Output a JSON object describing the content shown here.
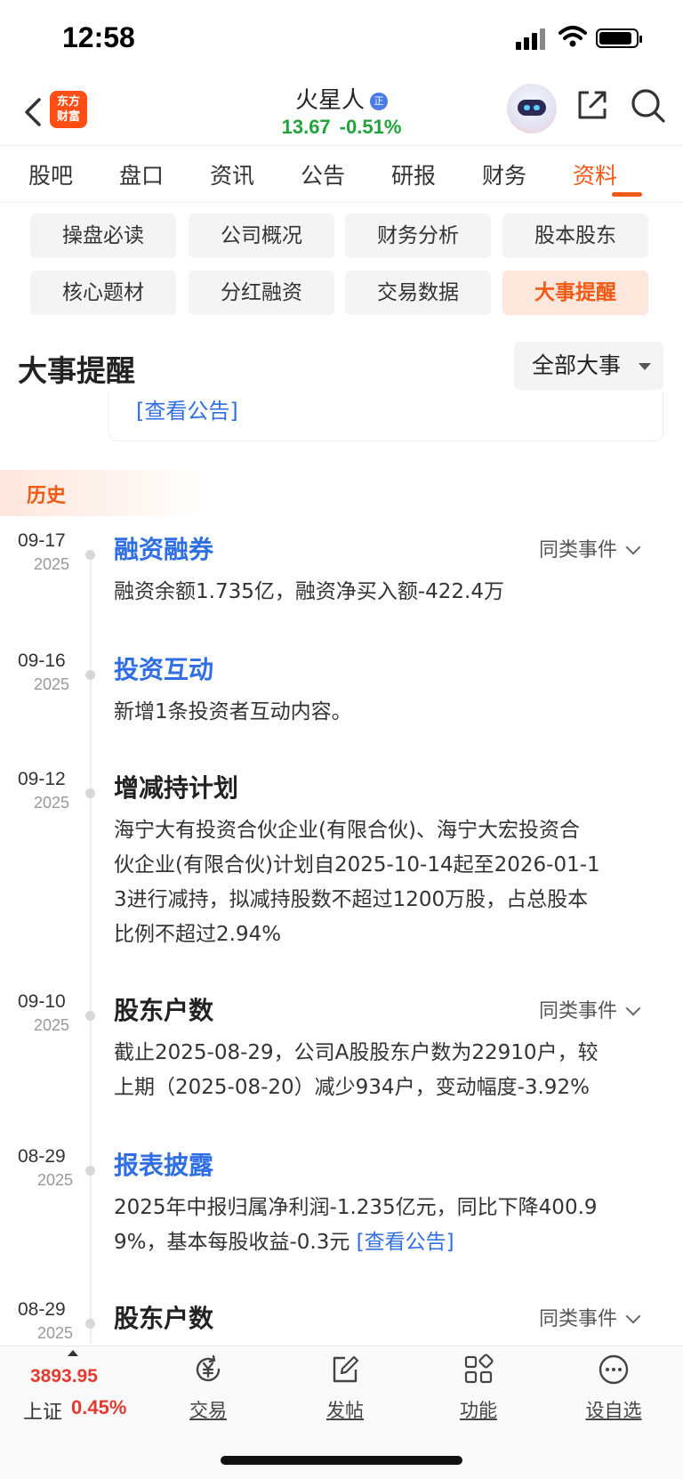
{
  "status_bar": {
    "time": "12:58"
  },
  "header": {
    "app_logo": "东方财富",
    "stock_name": "火星人",
    "reg_badge": "正",
    "price": "13.67",
    "change_pct": "-0.51%",
    "icons": [
      "back-icon",
      "robot-assistant-icon",
      "share-icon",
      "search-icon"
    ]
  },
  "tabs": [
    "股吧",
    "盘口",
    "资讯",
    "公告",
    "研报",
    "财务",
    "资料"
  ],
  "active_tab": "资料",
  "sub_tabs": [
    "操盘必读",
    "公司概况",
    "财务分析",
    "股本股东",
    "核心题材",
    "分红融资",
    "交易数据",
    "大事提醒"
  ],
  "active_sub_tab": "大事提醒",
  "section": {
    "title": "大事提醒",
    "filter": "全部大事",
    "prev_link": "[查看公告]",
    "history_label": "历史"
  },
  "similar_label": "同类事件",
  "events": [
    {
      "date": "09-17",
      "year": "2025",
      "title": "融资融券",
      "style": "blue",
      "similar": true,
      "lines": [
        "融资余额1.735亿，融资净买入额-422.4万"
      ]
    },
    {
      "date": "09-16",
      "year": "2025",
      "title": "投资互动",
      "style": "blue",
      "similar": false,
      "lines": [
        "新增1条投资者互动内容。"
      ]
    },
    {
      "date": "09-12",
      "year": "2025",
      "title": "增减持计划",
      "style": "dark",
      "similar": false,
      "lines": [
        "海宁大有投资合伙企业(有限合伙)、海宁大宏投资合",
        "伙企业(有限合伙)计划自2025-10-14起至2026-01-1",
        "3进行减持，拟减持股数不超过1200万股，占总股本",
        "比例不超过2.94%"
      ]
    },
    {
      "date": "09-10",
      "year": "2025",
      "title": "股东户数",
      "style": "dark",
      "similar": true,
      "lines": [
        "截止2025-08-29，公司A股股东户数为22910户，较",
        "上期（2025-08-20）减少934户，变动幅度-3.92%"
      ]
    },
    {
      "date": "08-29",
      "year": "2025",
      "title": "报表披露",
      "style": "blue",
      "similar": false,
      "lines": [
        "2025年中报归属净利润-1.235亿元，同比下降400.9",
        "9%，基本每股收益-0.3元"
      ],
      "link": "[查看公告]"
    },
    {
      "date": "08-29",
      "year": "2025",
      "title": "股东户数",
      "style": "dark",
      "similar": true,
      "lines": []
    }
  ],
  "bottom_bar": {
    "index_value": "3893.95",
    "index_name": "上证",
    "index_change": "0.45%",
    "nav": [
      {
        "label": "交易",
        "icon": "trade-yen-icon"
      },
      {
        "label": "发帖",
        "icon": "compose-icon"
      },
      {
        "label": "功能",
        "icon": "grid-icon"
      },
      {
        "label": "设自选",
        "icon": "more-dots-icon"
      }
    ]
  },
  "colors": {
    "accent": "#f05a14",
    "link": "#2f6fe3",
    "down": "#20a33a",
    "up": "#e23a2e"
  }
}
